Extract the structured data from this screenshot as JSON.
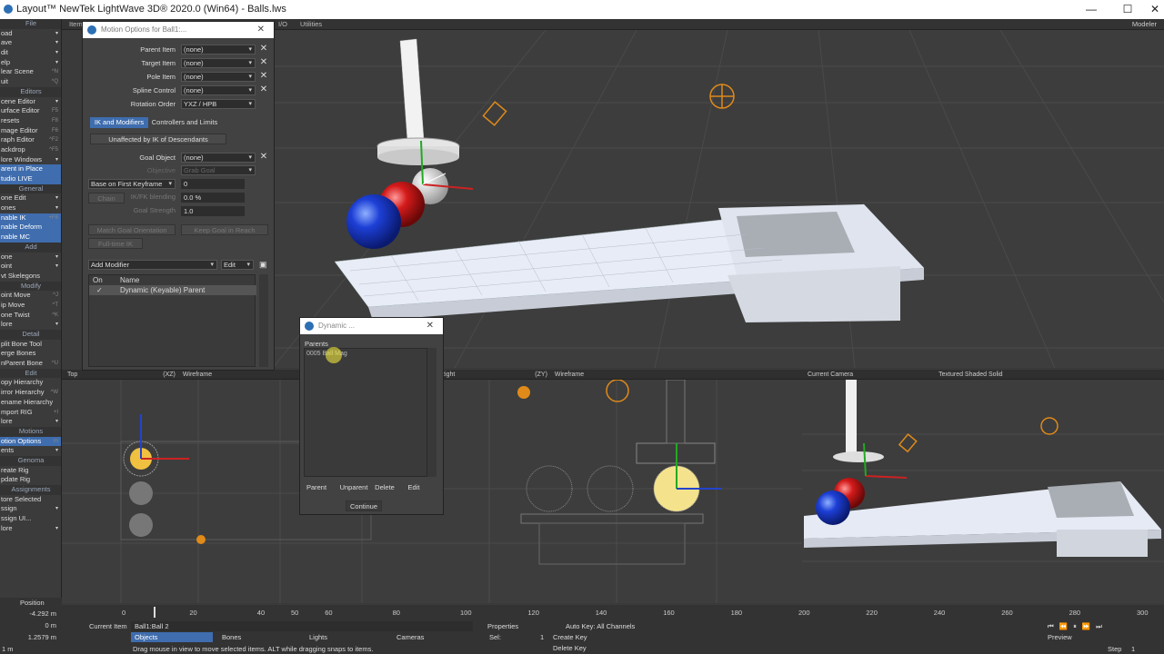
{
  "window": {
    "title": "Layout™ NewTek LightWave 3D® 2020.0 (Win64) - Balls.lws",
    "minimize": "—",
    "maximize": "☐",
    "close": "✕"
  },
  "topstrip": {
    "tabs": [
      "Item",
      "I/O",
      "Utilities"
    ],
    "modeler": "Modeler"
  },
  "leftbar": [
    {
      "t": "File",
      "h": true
    },
    {
      "t": "oad",
      "d": true
    },
    {
      "t": "ave",
      "d": true
    },
    {
      "t": "dit",
      "d": true
    },
    {
      "t": "elp",
      "d": true
    },
    {
      "t": "lear Scene",
      "s": "^N"
    },
    {
      "t": "uit",
      "s": "^Q"
    },
    {
      "t": "Editors",
      "h": true
    },
    {
      "t": "cene Editor",
      "d": true
    },
    {
      "t": "urface Editor",
      "s": "F5"
    },
    {
      "t": "resets",
      "s": "F8"
    },
    {
      "t": "mage Editor",
      "s": "F6"
    },
    {
      "t": "raph Editor",
      "s": "^F2"
    },
    {
      "t": "ackdrop",
      "s": "^F5"
    },
    {
      "t": "lore Windows",
      "d": true
    },
    {
      "t": "arent in Place",
      "sel": true
    },
    {
      "t": "tudio LIVE",
      "sel": true
    },
    {
      "t": "General",
      "h": true
    },
    {
      "t": "one Edit",
      "d": true
    },
    {
      "t": "ones",
      "d": true
    },
    {
      "t": "nable IK",
      "sel": true,
      "s": "+F8"
    },
    {
      "t": "nable Deform",
      "sel": true
    },
    {
      "t": "nable MC",
      "sel": true
    },
    {
      "t": "Add",
      "h": true
    },
    {
      "t": "one",
      "d": true
    },
    {
      "t": "oint",
      "d": true
    },
    {
      "t": "vt Skelegons"
    },
    {
      "t": "Modify",
      "h": true
    },
    {
      "t": "oint Move",
      "s": "^J"
    },
    {
      "t": "ip Move",
      "s": "^T"
    },
    {
      "t": "one Twist",
      "s": "^K"
    },
    {
      "t": "lore",
      "d": true
    },
    {
      "t": "Detail",
      "h": true
    },
    {
      "t": "plit Bone Tool"
    },
    {
      "t": "erge Bones"
    },
    {
      "t": "nParent Bone",
      "s": "^U"
    },
    {
      "t": "Edit",
      "h": true
    },
    {
      "t": "opy Hierarchy"
    },
    {
      "t": "irror Hierarchy",
      "s": "^W"
    },
    {
      "t": "ename Hierarchy"
    },
    {
      "t": "mport RIG",
      "s": "+I"
    },
    {
      "t": "lore",
      "d": true
    },
    {
      "t": "Motions",
      "h": true
    },
    {
      "t": "otion Options",
      "sel": true,
      "s": "m"
    },
    {
      "t": "ents",
      "d": true
    },
    {
      "t": "Genoma",
      "h": true
    },
    {
      "t": "reate Rig"
    },
    {
      "t": "pdate Rig"
    },
    {
      "t": "Assignments",
      "h": true
    },
    {
      "t": "tore Selected"
    },
    {
      "t": "ssign",
      "d": true
    },
    {
      "t": "ssign UI..."
    },
    {
      "t": "lore",
      "d": true
    }
  ],
  "leftstatus": {
    "position": "Position",
    "x": "-4.292 m",
    "y": "0 m",
    "z": "1.2579 m",
    "grid": "1 m"
  },
  "motion": {
    "title": "Motion Options for Ball1:...",
    "parent_item": {
      "label": "Parent Item",
      "value": "(none)"
    },
    "target_item": {
      "label": "Target Item",
      "value": "(none)"
    },
    "pole_item": {
      "label": "Pole Item",
      "value": "(none)"
    },
    "spline_control": {
      "label": "Spline Control",
      "value": "(none)"
    },
    "rotation_order": {
      "label": "Rotation Order",
      "value": "YXZ / HPB"
    },
    "tabs": [
      "IK and Modifiers",
      "Controllers and Limits"
    ],
    "unaffected": "Unaffected by IK of Descendants",
    "goal_object": {
      "label": "Goal Object",
      "value": "(none)"
    },
    "objective": {
      "label": "Objective",
      "value": "Grab Goal"
    },
    "base": {
      "value": "Base on First Keyframe",
      "field": "0"
    },
    "chain": "Chain",
    "blending": {
      "label": "IK/FK blending",
      "value": "0.0 %"
    },
    "strength": {
      "label": "Goal Strength",
      "value": "1.0"
    },
    "match_goal": "Match Goal Orientation",
    "keep_goal": "Keep Goal in Reach",
    "full_time": "Full-time IK",
    "add_modifier": "Add Modifier",
    "edit": "Edit",
    "col_on": "On",
    "col_name": "Name",
    "modifier_row": {
      "on": "✓",
      "name": "Dynamic (Keyable) Parent"
    }
  },
  "dyn": {
    "title": "Dynamic ...",
    "parents_label": "Parents",
    "row": "0005 Ball Mag",
    "parent": "Parent",
    "unparent": "Unparent",
    "delete": "Delete",
    "edit": "Edit",
    "continue": "Continue"
  },
  "vp_bl": {
    "name": "Top",
    "axis": "(XZ)",
    "mode": "Wireframe"
  },
  "vp_bm": {
    "name": "Right",
    "axis": "(ZY)",
    "mode": "Wireframe"
  },
  "vp_br": {
    "name": "Current Camera",
    "mode": "Textured Shaded Solid"
  },
  "vp_top": {
    "name": "Perspective"
  },
  "timeline": {
    "ticks": [
      "0",
      "20",
      "40",
      "50",
      "60",
      "80",
      "100",
      "120",
      "140",
      "160",
      "180",
      "200",
      "220",
      "240",
      "260",
      "280",
      "300"
    ],
    "end": "300",
    "current": "0"
  },
  "bottom": {
    "current_item_label": "Current Item",
    "current_item": "Ball1:Ball 2",
    "properties": "Properties",
    "sel_label": "Sel:",
    "sel_value": "1",
    "auto_key": "Auto Key: All Channels",
    "create_key": "Create Key",
    "delete_key": "Delete Key",
    "objects": "Objects",
    "bones": "Bones",
    "lights": "Lights",
    "cameras": "Cameras",
    "status": "Drag mouse in view to move selected items. ALT while dragging snaps to items.",
    "preview": "Preview",
    "step_label": "Step",
    "step_value": "1"
  }
}
